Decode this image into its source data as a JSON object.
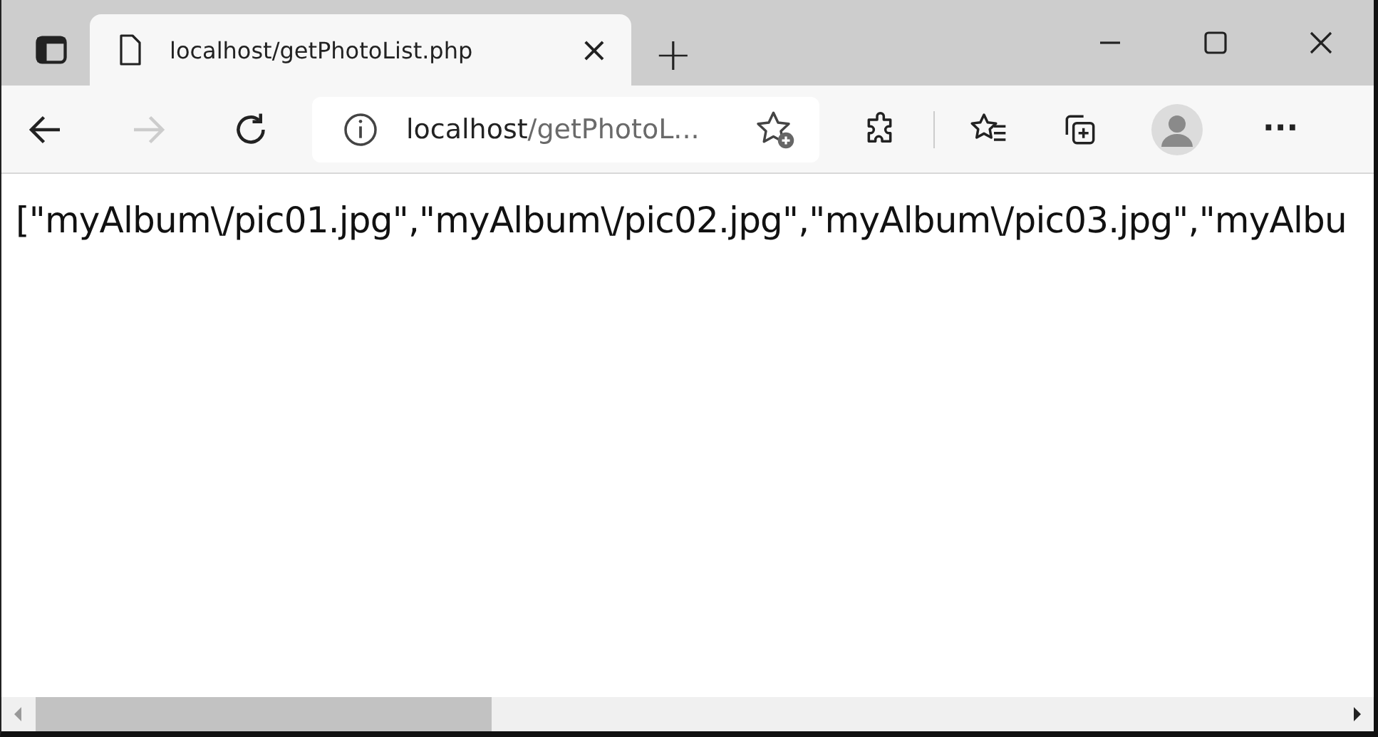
{
  "tab": {
    "title": "localhost/getPhotoList.php",
    "close": "×",
    "selected": true
  },
  "new_tab": "+",
  "nav": {
    "back_disabled": false,
    "forward_disabled": true
  },
  "address": {
    "host": "localhost",
    "path": "/getPhotoL..."
  },
  "more": "···",
  "body_text": "[\"myAlbum\\/pic01.jpg\",\"myAlbum\\/pic02.jpg\",\"myAlbum\\/pic03.jpg\",\"myAlbu"
}
